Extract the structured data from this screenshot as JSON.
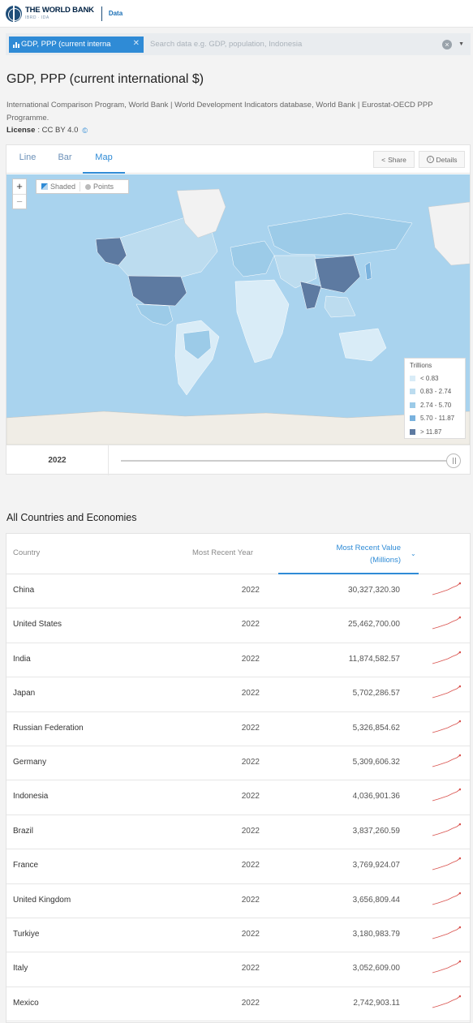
{
  "header": {
    "logo_title": "THE WORLD BANK",
    "logo_sub": "IBRD · IDA",
    "data_link": "Data"
  },
  "search": {
    "chip_label": "GDP, PPP (current interna",
    "placeholder": "Search data e.g. GDP, population, Indonesia"
  },
  "indicator": {
    "title": "GDP, PPP (current international $)",
    "sources": "International Comparison Program, World Bank | World Development Indicators database, World Bank | Eurostat-OECD PPP Programme.",
    "license_label": "License",
    "license_value": ": CC BY 4.0"
  },
  "chart_tabs": [
    {
      "label": "Line",
      "active": false
    },
    {
      "label": "Bar",
      "active": false
    },
    {
      "label": "Map",
      "active": true
    }
  ],
  "actions": {
    "share": "Share",
    "details": "Details"
  },
  "map": {
    "toggle_shaded": "Shaded",
    "toggle_points": "Points",
    "legend_title": "Trillions",
    "legend": [
      {
        "label": "< 0.83",
        "color": "#d9ecf7"
      },
      {
        "label": "0.83 - 2.74",
        "color": "#bcdcef"
      },
      {
        "label": "2.74 - 5.70",
        "color": "#9ccbe8"
      },
      {
        "label": "5.70 - 11.87",
        "color": "#79b2de"
      },
      {
        "label": "> 11.87",
        "color": "#5d7aa1"
      }
    ],
    "year": "2022",
    "ocean_color": "#a9d3ee"
  },
  "table": {
    "section_title": "All Countries and Economies",
    "col_country": "Country",
    "col_year": "Most Recent Year",
    "col_value_line1": "Most Recent Value",
    "col_value_line2": "(Millions)",
    "rows": [
      {
        "country": "China",
        "year": "2022",
        "value": "30,327,320.30"
      },
      {
        "country": "United States",
        "year": "2022",
        "value": "25,462,700.00"
      },
      {
        "country": "India",
        "year": "2022",
        "value": "11,874,582.57"
      },
      {
        "country": "Japan",
        "year": "2022",
        "value": "5,702,286.57"
      },
      {
        "country": "Russian Federation",
        "year": "2022",
        "value": "5,326,854.62"
      },
      {
        "country": "Germany",
        "year": "2022",
        "value": "5,309,606.32"
      },
      {
        "country": "Indonesia",
        "year": "2022",
        "value": "4,036,901.36"
      },
      {
        "country": "Brazil",
        "year": "2022",
        "value": "3,837,260.59"
      },
      {
        "country": "France",
        "year": "2022",
        "value": "3,769,924.07"
      },
      {
        "country": "United Kingdom",
        "year": "2022",
        "value": "3,656,809.44"
      },
      {
        "country": "Turkiye",
        "year": "2022",
        "value": "3,180,983.79"
      },
      {
        "country": "Italy",
        "year": "2022",
        "value": "3,052,609.00"
      },
      {
        "country": "Mexico",
        "year": "2022",
        "value": "2,742,903.11"
      }
    ]
  }
}
